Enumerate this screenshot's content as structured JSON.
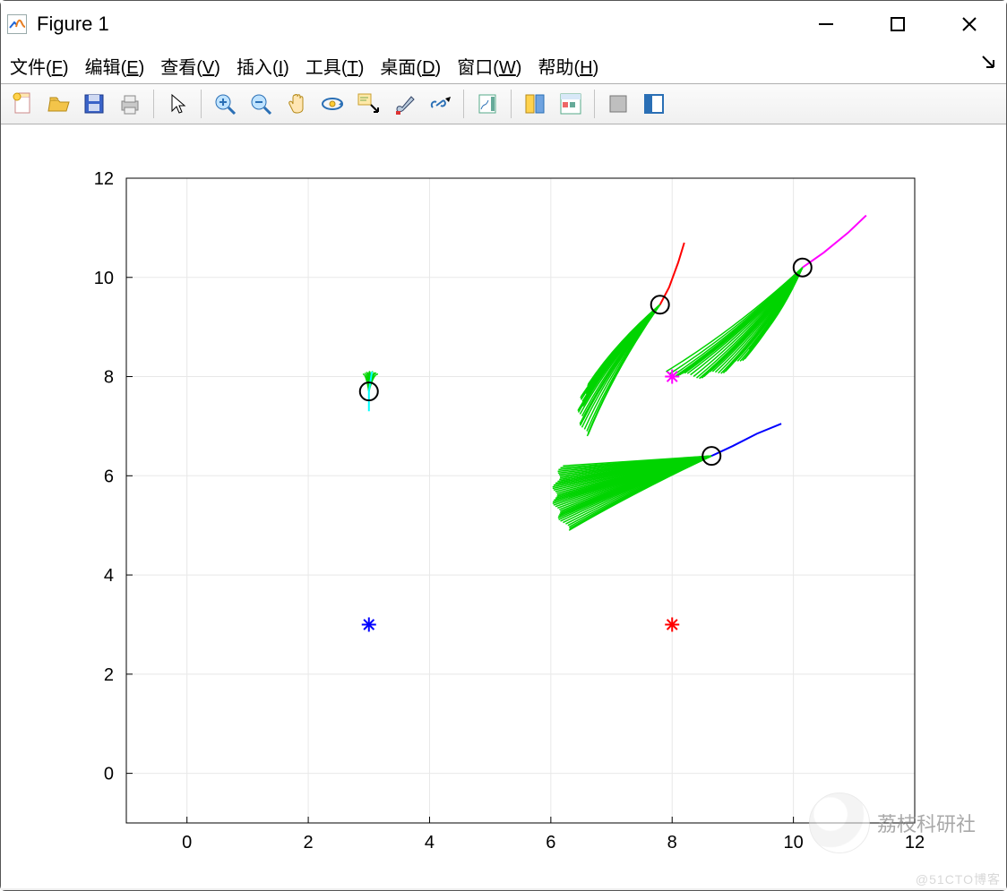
{
  "window": {
    "title": "Figure 1"
  },
  "menu": {
    "file": {
      "label": "文件",
      "accel": "F"
    },
    "edit": {
      "label": "编辑",
      "accel": "E"
    },
    "view": {
      "label": "查看",
      "accel": "V"
    },
    "insert": {
      "label": "插入",
      "accel": "I"
    },
    "tools": {
      "label": "工具",
      "accel": "T"
    },
    "desktop": {
      "label": "桌面",
      "accel": "D"
    },
    "window": {
      "label": "窗口",
      "accel": "W"
    },
    "help": {
      "label": "帮助",
      "accel": "H"
    }
  },
  "toolbar_icons": [
    "new-figure-icon",
    "open-icon",
    "save-icon",
    "print-icon",
    "sep",
    "pointer-icon",
    "sep",
    "zoom-in-icon",
    "zoom-out-icon",
    "pan-icon",
    "rotate3d-icon",
    "data-cursor-icon",
    "brush-icon",
    "link-icon",
    "sep",
    "insert-colorbar-icon",
    "sep",
    "insert-legend-icon",
    "hide-plot-tools-icon",
    "sep",
    "property-editor-icon",
    "dock-icon"
  ],
  "overlay": {
    "watermark": "@51CTO博客",
    "qr_text": "荔枝科研社"
  },
  "chart_data": {
    "type": "scatter",
    "xlim": [
      -1,
      12
    ],
    "ylim": [
      -1,
      12
    ],
    "xticks": [
      0,
      2,
      4,
      6,
      8,
      10,
      12
    ],
    "yticks": [
      0,
      2,
      4,
      6,
      8,
      10,
      12
    ],
    "title": "",
    "xlabel": "",
    "ylabel": "",
    "grid": true,
    "star_markers": [
      {
        "x": 3.0,
        "y": 3.0,
        "color": "#0000ff"
      },
      {
        "x": 8.0,
        "y": 3.0,
        "color": "#ff0000"
      },
      {
        "x": 8.0,
        "y": 8.0,
        "color": "#ff00ff"
      }
    ],
    "circle_markers": [
      {
        "x": 3.0,
        "y": 7.7
      },
      {
        "x": 7.8,
        "y": 9.45
      },
      {
        "x": 8.65,
        "y": 6.4
      },
      {
        "x": 10.15,
        "y": 10.2
      }
    ],
    "colored_curves": [
      {
        "color": "#00ffff",
        "pts": [
          [
            3.0,
            7.3
          ],
          [
            3.0,
            7.7
          ],
          [
            3.05,
            8.1
          ]
        ]
      },
      {
        "color": "#ff0000",
        "pts": [
          [
            7.8,
            9.45
          ],
          [
            7.95,
            9.8
          ],
          [
            8.1,
            10.3
          ],
          [
            8.2,
            10.7
          ]
        ]
      },
      {
        "color": "#0000ff",
        "pts": [
          [
            8.65,
            6.4
          ],
          [
            9.0,
            6.6
          ],
          [
            9.4,
            6.85
          ],
          [
            9.8,
            7.05
          ]
        ]
      },
      {
        "color": "#ff00ff",
        "pts": [
          [
            10.15,
            10.2
          ],
          [
            10.5,
            10.5
          ],
          [
            10.9,
            10.9
          ],
          [
            11.2,
            11.25
          ]
        ]
      }
    ],
    "green_fans": [
      {
        "tip": [
          8.65,
          6.4
        ],
        "end_arc_start": [
          6.3,
          4.9
        ],
        "end_arc_end": [
          6.2,
          6.2
        ],
        "n_lines": 40,
        "scallop_amp": 0.15
      },
      {
        "tip": [
          7.8,
          9.45
        ],
        "end_arc_start": [
          6.6,
          6.8
        ],
        "end_arc_end": [
          6.7,
          7.9
        ],
        "n_lines": 35,
        "scallop_amp": 0.15
      },
      {
        "tip": [
          10.15,
          10.2
        ],
        "end_arc_start": [
          7.9,
          8.1
        ],
        "end_arc_end": [
          9.4,
          8.7
        ],
        "n_lines": 40,
        "scallop_amp": 0.15
      },
      {
        "tip": [
          3.0,
          7.7
        ],
        "end_arc_start": [
          2.9,
          8.05
        ],
        "end_arc_end": [
          3.15,
          8.05
        ],
        "n_lines": 10,
        "scallop_amp": 0.03
      }
    ]
  }
}
